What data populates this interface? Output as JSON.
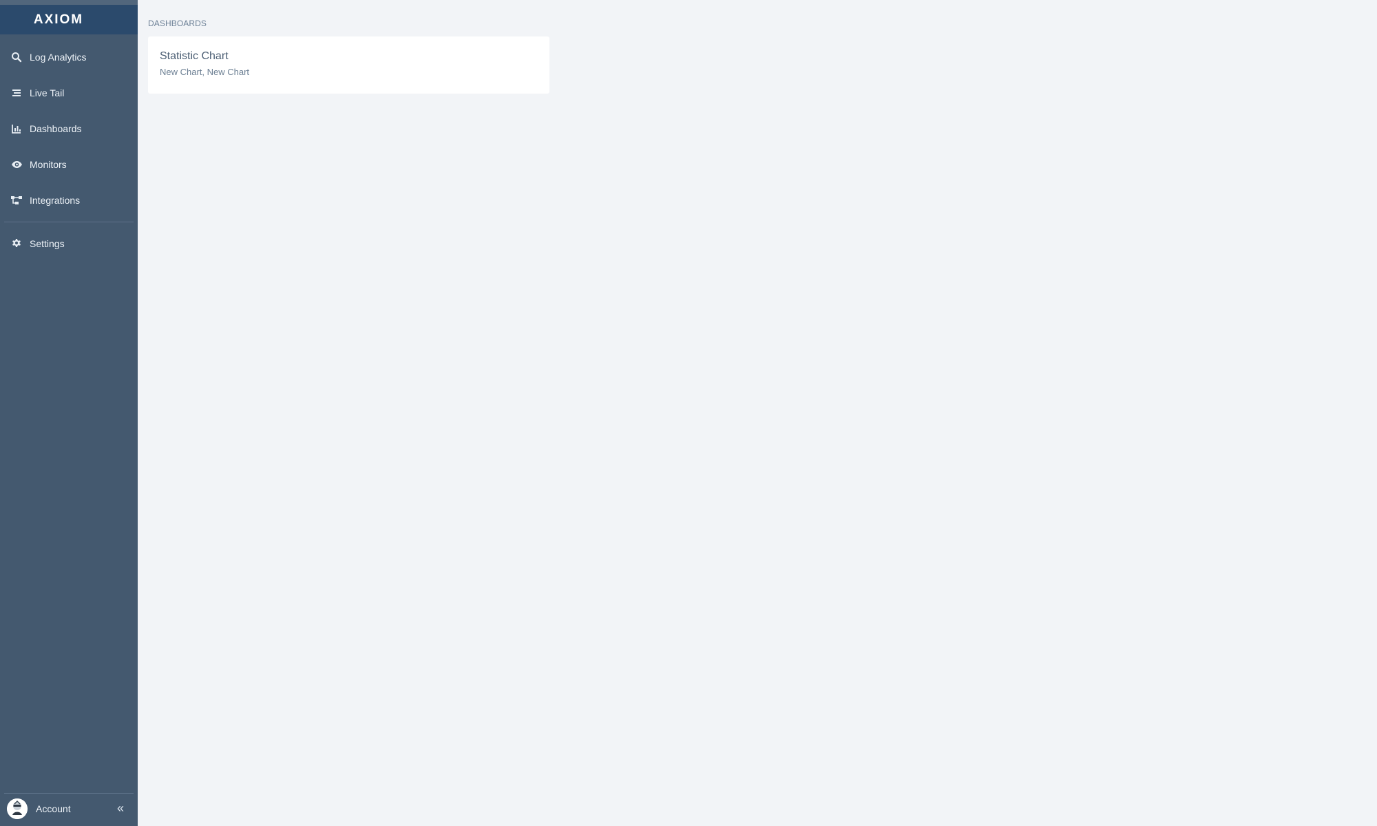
{
  "app": {
    "brand": "AXIOM"
  },
  "sidebar": {
    "items": [
      {
        "label": "Log Analytics",
        "icon": "search-icon"
      },
      {
        "label": "Live Tail",
        "icon": "live-tail-icon"
      },
      {
        "label": "Dashboards",
        "icon": "dashboards-icon"
      },
      {
        "label": "Monitors",
        "icon": "monitor-eye-icon"
      },
      {
        "label": "Integrations",
        "icon": "integrations-icon"
      }
    ],
    "settings": {
      "label": "Settings",
      "icon": "gear-icon"
    },
    "account": {
      "label": "Account",
      "collapse_icon": "double-chevron-left-icon"
    }
  },
  "main": {
    "breadcrumb": "DASHBOARDS",
    "card": {
      "title": "Statistic Chart",
      "subtitle": "New Chart, New Chart"
    }
  },
  "colors": {
    "sidebar": "#44596f",
    "brand_bar": "#2b4a6c",
    "page_background": "#f2f4f7",
    "card_background": "#ffffff"
  }
}
